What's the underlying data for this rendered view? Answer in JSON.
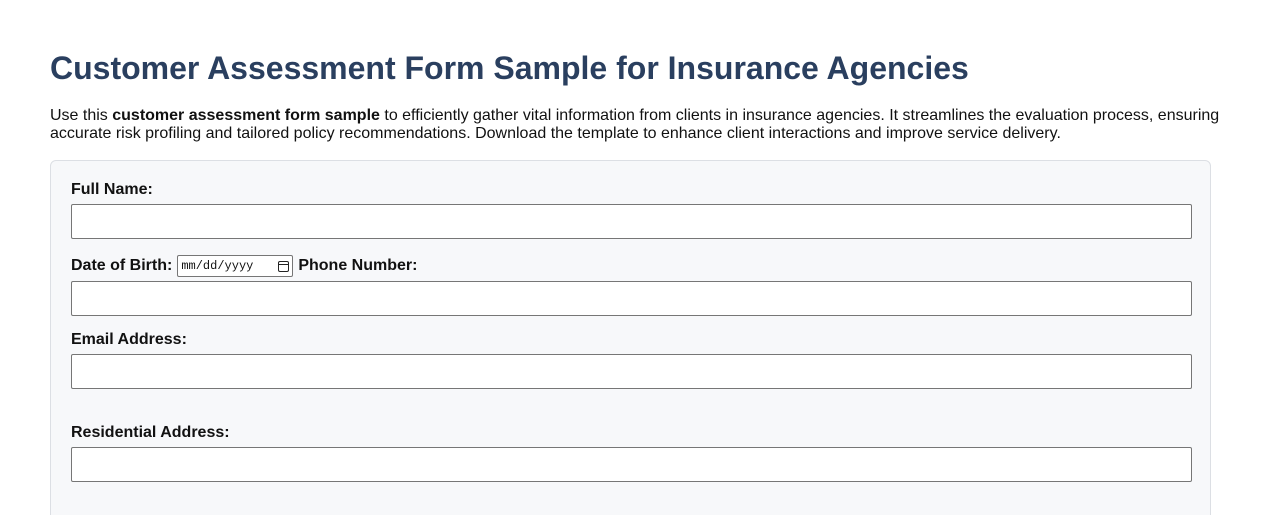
{
  "page": {
    "title": "Customer Assessment Form Sample for Insurance Agencies",
    "intro_prefix": "Use this ",
    "intro_bold": "customer assessment form sample",
    "intro_suffix": " to efficiently gather vital information from clients in insurance agencies. It streamlines the evaluation process, ensuring accurate risk profiling and tailored policy recommendations. Download the template to enhance client interactions and improve service delivery."
  },
  "form": {
    "full_name_label": "Full Name:",
    "full_name_value": "",
    "dob_label": "Date of Birth:",
    "dob_placeholder": "mm/dd/yyyy",
    "dob_icon": "calendar-icon",
    "phone_label": "Phone Number:",
    "phone_value": "",
    "email_label": "Email Address:",
    "email_value": "",
    "address_label": "Residential Address:",
    "address_value": ""
  },
  "colors": {
    "title": "#2a3f5f",
    "card_background": "#f7f8fa",
    "card_border": "#dcdfe4",
    "input_border": "#767676"
  }
}
